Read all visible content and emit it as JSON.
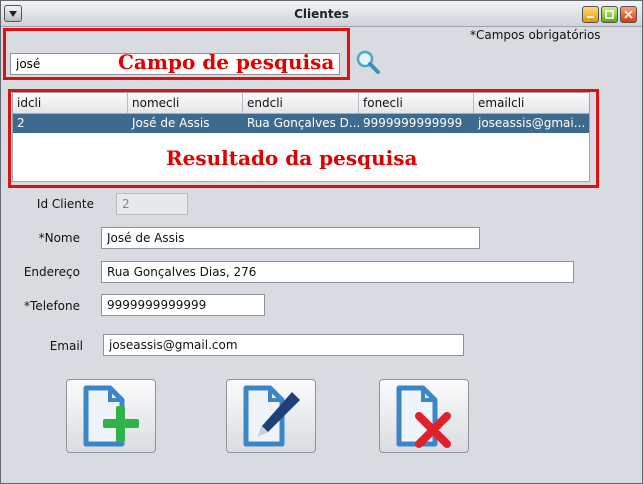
{
  "window": {
    "title": "Clientes",
    "required_note": "*Campos obrigatórios"
  },
  "search": {
    "value": "josé",
    "annotation": "Campo de pesquisa",
    "button_icon": "magnifier-icon"
  },
  "results": {
    "annotation": "Resultado da pesquisa",
    "columns": [
      "idcli",
      "nomecli",
      "endcli",
      "fonecli",
      "emailcli"
    ],
    "rows": [
      [
        "2",
        "José de Assis",
        "Rua Gonçalves D...",
        "9999999999999",
        "joseassis@gmai..."
      ]
    ]
  },
  "form": {
    "id_label": "Id Cliente",
    "id_value": "2",
    "nome_label": "*Nome",
    "nome_value": "José de Assis",
    "endereco_label": "Endereço",
    "endereco_value": "Rua Gonçalves Dias, 276",
    "telefone_label": "*Telefone",
    "telefone_value": "9999999999999",
    "email_label": "Email",
    "email_value": "joseassis@gmail.com"
  },
  "actions": {
    "add_icon": "document-add-icon",
    "edit_icon": "document-edit-icon",
    "delete_icon": "document-delete-icon"
  },
  "colors": {
    "annotation_red": "#e00000",
    "selection_blue": "#3d6a8f",
    "icon_blue": "#3a86c8",
    "add_green": "#2fb24a",
    "delete_red": "#e0202a"
  }
}
